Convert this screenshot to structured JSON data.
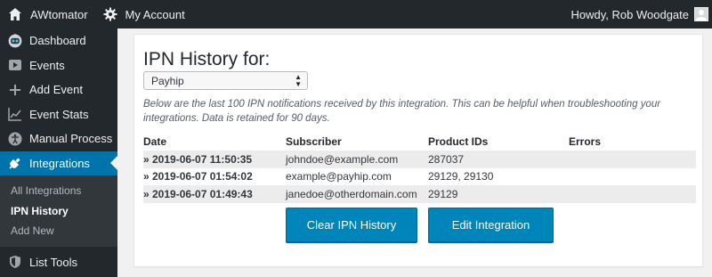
{
  "adminbar": {
    "site_name": "AWtomator",
    "account_label": "My Account",
    "greeting": "Howdy, Rob Woodgate"
  },
  "sidebar": {
    "items": [
      {
        "label": "Dashboard",
        "icon": "robot-icon"
      },
      {
        "label": "Events",
        "icon": "play-icon"
      },
      {
        "label": "Add Event",
        "icon": "plus-icon"
      },
      {
        "label": "Event Stats",
        "icon": "chart-icon"
      },
      {
        "label": "Manual Process",
        "icon": "accessibility-icon"
      },
      {
        "label": "Integrations",
        "icon": "plug-icon"
      }
    ],
    "submenu": [
      {
        "label": "All Integrations"
      },
      {
        "label": "IPN History"
      },
      {
        "label": "Add New"
      }
    ],
    "last_item": {
      "label": "List Tools",
      "icon": "shield-icon"
    },
    "accent": "#0073aa"
  },
  "main": {
    "title": "IPN History for:",
    "select_value": "Payhip",
    "description": "Below are the last 100 IPN notifications received by this integration. This can be helpful when troubleshooting your integrations. Data is retained for 90 days.",
    "columns": [
      "Date",
      "Subscriber",
      "Product IDs",
      "Errors"
    ],
    "rows": [
      {
        "date": "» 2019-06-07 11:50:35",
        "subscriber": "johndoe@example.com",
        "products": "287037",
        "errors": ""
      },
      {
        "date": "» 2019-06-07 01:54:02",
        "subscriber": "example@payhip.com",
        "products": "29129, 29130",
        "errors": ""
      },
      {
        "date": "» 2019-06-07 01:49:43",
        "subscriber": "janedoe@otherdomain.com",
        "products": "29129",
        "errors": ""
      }
    ],
    "buttons": {
      "clear": "Clear IPN History",
      "edit": "Edit Integration"
    },
    "button_color": "#0085ba"
  }
}
